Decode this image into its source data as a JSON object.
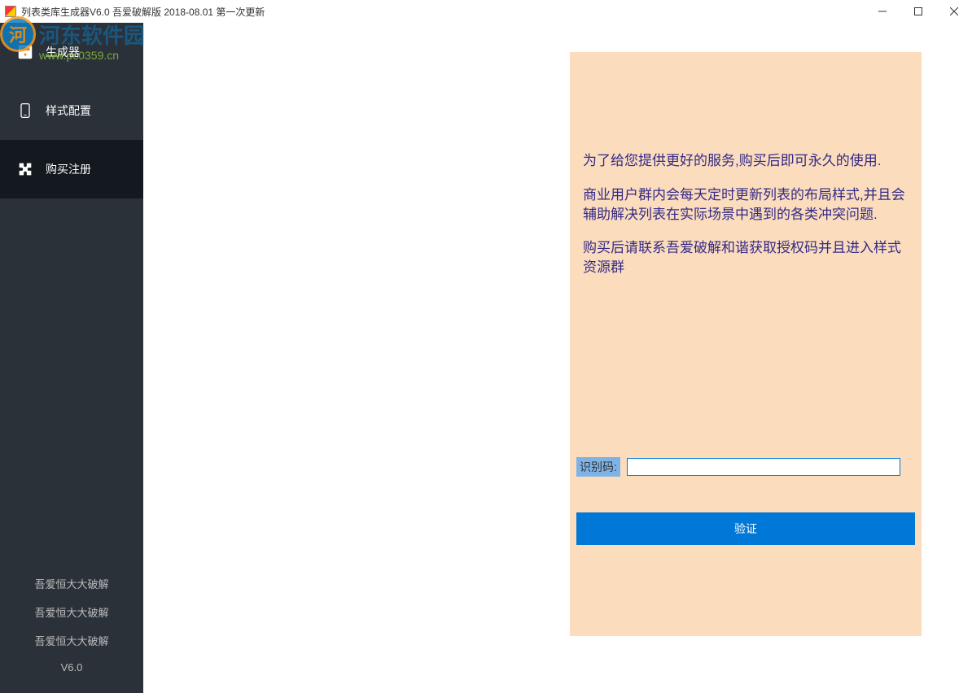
{
  "window": {
    "title": "列表类库生成器V6.0 吾爱破解版 2018-08.01 第一次更新"
  },
  "watermark": {
    "logo_text": "河东软件园",
    "url": "www.pc0359.cn"
  },
  "sidebar": {
    "items": [
      {
        "label": "生成器"
      },
      {
        "label": "样式配置"
      },
      {
        "label": "购买注册"
      }
    ],
    "footer": {
      "line1": "吾爱恒大大破解",
      "line2": "吾爱恒大大破解",
      "line3": "吾爱恒大大破解",
      "version": "V6.0"
    }
  },
  "panel": {
    "paragraph1": "为了给您提供更好的服务,购买后即可永久的使用.",
    "paragraph2": "商业用户群内会每天定时更新列表的布局样式,并且会辅助解决列表在实际场景中遇到的各类冲突问题.",
    "paragraph3": "购买后请联系吾爱破解和谐获取授权码并且进入样式资源群",
    "id_label": "识别码:",
    "id_value": "",
    "verify_button": "验证"
  }
}
